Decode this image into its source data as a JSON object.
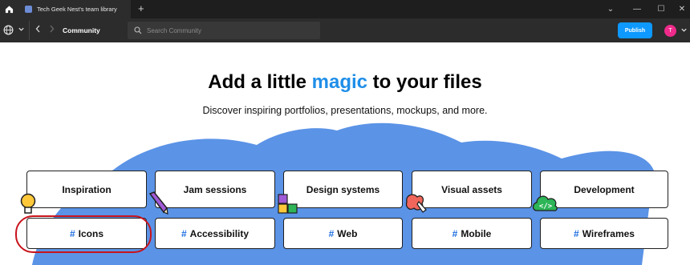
{
  "window": {
    "tab_title": "Tech Geek Nest's team library",
    "new_tab_label": "+",
    "minimize_label": "—",
    "maximize_label": "☐",
    "close_label": "✕",
    "dropdown_label": "⌄"
  },
  "toolbar": {
    "breadcrumb": "Community",
    "search_placeholder": "Search Community",
    "publish_label": "Publish",
    "avatar_initial": "T"
  },
  "hero": {
    "title_before": "Add a little ",
    "title_highlight": "magic",
    "title_after": " to your files",
    "subtitle": "Discover inspiring portfolios, presentations, mockups, and more."
  },
  "categories": [
    {
      "label": "Inspiration"
    },
    {
      "label": "Jam sessions"
    },
    {
      "label": "Design systems"
    },
    {
      "label": "Visual assets"
    },
    {
      "label": "Development"
    }
  ],
  "tags": [
    {
      "hash": "#",
      "label": "Icons"
    },
    {
      "hash": "#",
      "label": "Accessibility"
    },
    {
      "hash": "#",
      "label": "Web"
    },
    {
      "hash": "#",
      "label": "Mobile"
    },
    {
      "hash": "#",
      "label": "Wireframes"
    }
  ],
  "colors": {
    "accent": "#1f8ee8",
    "publish": "#0d99ff",
    "blob": "#5b93e6",
    "highlight": "#c8131b",
    "avatar": "#ef2a8a"
  },
  "icons": {
    "home": "home-icon",
    "tab": "figma-file-icon",
    "globe": "globe-icon",
    "search": "search-icon",
    "back": "chevron-left-icon",
    "forward": "chevron-right-icon"
  }
}
